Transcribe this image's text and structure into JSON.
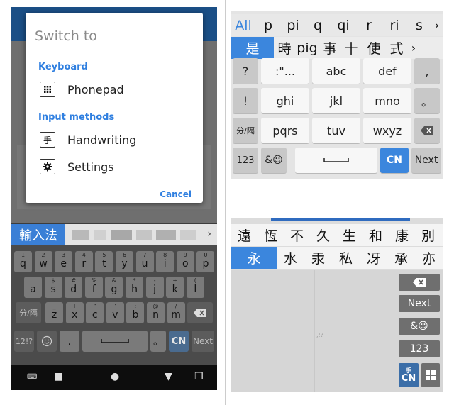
{
  "panelA": {
    "dialog": {
      "title": "Switch to",
      "keyboard_section": "Keyboard",
      "phonepad_label": "Phonepad",
      "input_methods_section": "Input methods",
      "handwriting_label": "Handwriting",
      "handwriting_icon_glyph": "手",
      "settings_label": "Settings",
      "cancel_label": "Cancel"
    },
    "ime_tag": "輸入法",
    "chevron": "›",
    "row1": [
      {
        "k": "q",
        "h": "1"
      },
      {
        "k": "w",
        "h": "2"
      },
      {
        "k": "e",
        "h": "3"
      },
      {
        "k": "r",
        "h": "4"
      },
      {
        "k": "t",
        "h": "5"
      },
      {
        "k": "y",
        "h": "6"
      },
      {
        "k": "u",
        "h": "7"
      },
      {
        "k": "i",
        "h": "8"
      },
      {
        "k": "o",
        "h": "9"
      },
      {
        "k": "p",
        "h": "0"
      }
    ],
    "row2": [
      {
        "k": "a",
        "h": "!"
      },
      {
        "k": "s",
        "h": "$"
      },
      {
        "k": "d",
        "h": "#"
      },
      {
        "k": "f",
        "h": "%"
      },
      {
        "k": "g",
        "h": "&"
      },
      {
        "k": "h",
        "h": "*"
      },
      {
        "k": "j",
        "h": "-"
      },
      {
        "k": "k",
        "h": "+"
      },
      {
        "k": "l",
        "h": "("
      }
    ],
    "row3_left": "分/隔",
    "row3": [
      {
        "k": "z",
        "h": "_"
      },
      {
        "k": "x",
        "h": "+"
      },
      {
        "k": "c",
        "h": "\""
      },
      {
        "k": "v",
        "h": "'"
      },
      {
        "k": "b",
        "h": ":"
      },
      {
        "k": "n",
        "h": "@"
      },
      {
        "k": "m",
        "h": "/"
      }
    ],
    "row4": {
      "num": "12!?",
      "comma": ",",
      "period": "。",
      "lang": "CN",
      "next": "Next"
    }
  },
  "panelB": {
    "pinyin": [
      "All",
      "p",
      "pi",
      "q",
      "qi",
      "r",
      "ri",
      "s"
    ],
    "candidates": [
      "是",
      "時",
      "pig",
      "事",
      "十",
      "使",
      "式"
    ],
    "rows": [
      [
        "?",
        ":\"...",
        "abc",
        "def",
        ","
      ],
      [
        "!",
        "ghi",
        "jkl",
        "mno",
        "。"
      ],
      [
        "分/隔",
        "pqrs",
        "tuv",
        "wxyz"
      ]
    ],
    "bottom": {
      "num": "123",
      "sym": "&☺",
      "lang": "CN",
      "next": "Next"
    },
    "chevron": "›"
  },
  "panelC": {
    "row1": [
      "遠",
      "恆",
      "不",
      "久",
      "生",
      "和",
      "康",
      "別"
    ],
    "row2": [
      "永",
      "水",
      "汞",
      "私",
      "冴",
      "承",
      "亦"
    ],
    "side": {
      "next": "Next",
      "sym": "&☺",
      "num": "123",
      "lang": "CN",
      "lang_hint": "手"
    },
    "hint": ",!?"
  },
  "colors": {
    "accent": "#3b86dd",
    "dialog_blue": "#2f7fe0"
  }
}
